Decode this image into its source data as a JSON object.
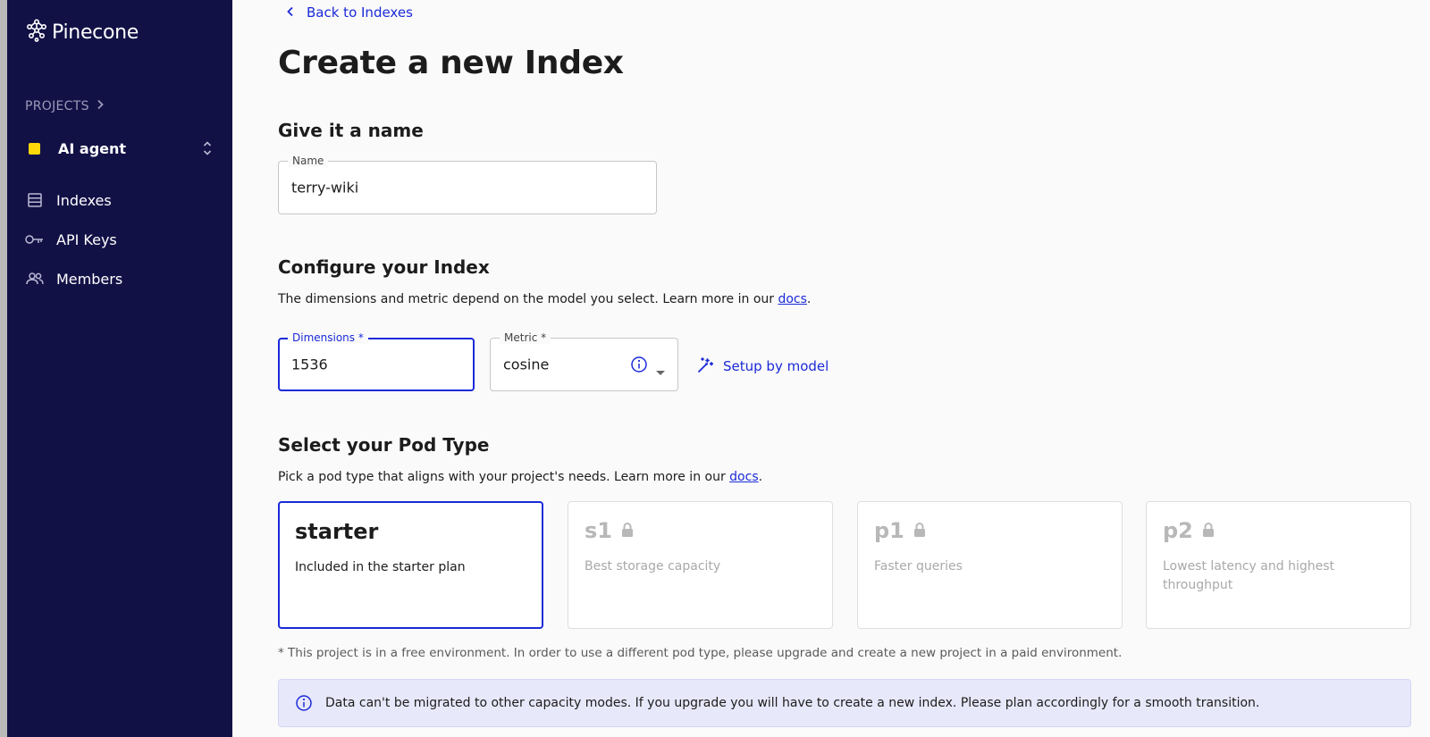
{
  "sidebar": {
    "brand": "Pinecone",
    "projects_label": "PROJECTS",
    "current_project": "AI agent",
    "items": [
      {
        "label": "Indexes",
        "icon": "list-icon"
      },
      {
        "label": "API Keys",
        "icon": "key-icon"
      },
      {
        "label": "Members",
        "icon": "people-icon"
      }
    ]
  },
  "main": {
    "back_link": "Back to Indexes",
    "title": "Create a new Index",
    "name_section": {
      "title": "Give it a name",
      "field_label": "Name",
      "field_value": "terry-wiki"
    },
    "config_section": {
      "title": "Configure your Index",
      "desc_prefix": "The dimensions and metric depend on the model you select. Learn more in our ",
      "desc_link": "docs",
      "desc_suffix": ".",
      "dimensions_label": "Dimensions *",
      "dimensions_value": "1536",
      "metric_label": "Metric *",
      "metric_value": "cosine",
      "setup_button": "Setup by model"
    },
    "pod_section": {
      "title": "Select your Pod Type",
      "desc_prefix": "Pick a pod type that aligns with your project's needs. Learn more in our ",
      "desc_link": "docs",
      "desc_suffix": ".",
      "pods": [
        {
          "name": "starter",
          "desc": "Included in the starter plan",
          "locked": false,
          "selected": true
        },
        {
          "name": "s1",
          "desc": "Best storage capacity",
          "locked": true,
          "selected": false
        },
        {
          "name": "p1",
          "desc": "Faster queries",
          "locked": true,
          "selected": false
        },
        {
          "name": "p2",
          "desc": "Lowest latency and highest throughput",
          "locked": true,
          "selected": false
        }
      ],
      "footnote": "* This project is in a free environment. In order to use a different pod type, please upgrade and create a new project in a paid environment."
    },
    "alert": "Data can't be migrated to other capacity modes. If you upgrade you will have to create a new index. Please plan accordingly for a smooth transition."
  },
  "colors": {
    "sidebar_bg": "#121146",
    "accent": "#1b2ad8",
    "project_dot": "#fed809",
    "alert_bg": "#e8e8fb"
  }
}
